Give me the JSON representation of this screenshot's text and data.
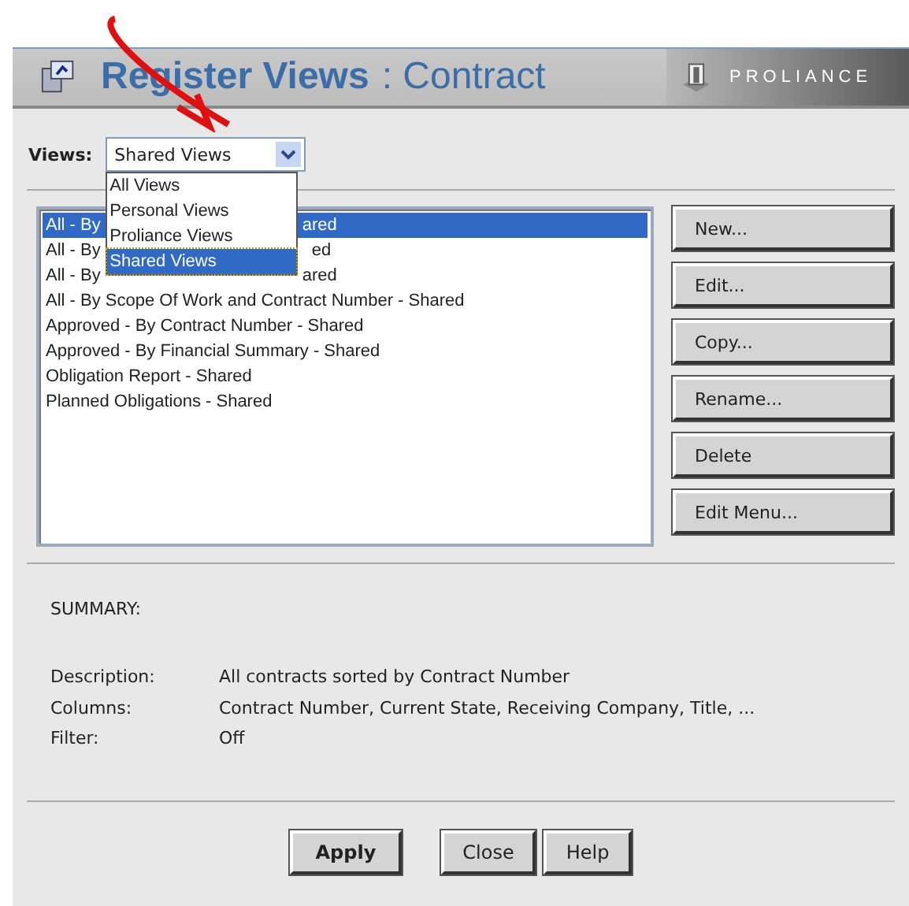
{
  "header": {
    "title": "Register Views",
    "subtitle": ": Contract",
    "brand": "PROLIANCE"
  },
  "views": {
    "label": "Views:",
    "value": "Shared Views",
    "expanded": true,
    "options": [
      {
        "label": "All Views",
        "selected": false
      },
      {
        "label": "Personal Views",
        "selected": false
      },
      {
        "label": "Proliance Views",
        "selected": false
      },
      {
        "label": "Shared Views",
        "selected": true
      }
    ]
  },
  "view_list": [
    {
      "parts": [
        "All - By",
        "ared"
      ],
      "selected": true
    },
    {
      "parts": [
        "All - By",
        "ed"
      ],
      "selected": false
    },
    {
      "parts": [
        "All - By",
        "ared"
      ],
      "selected": false
    },
    {
      "parts": [
        "All - By Scope Of Work and Contract Number - Shared"
      ],
      "selected": false
    },
    {
      "parts": [
        "Approved - By Contract Number - Shared"
      ],
      "selected": false
    },
    {
      "parts": [
        "Approved - By Financial Summary - Shared"
      ],
      "selected": false
    },
    {
      "parts": [
        "Obligation Report - Shared"
      ],
      "selected": false
    },
    {
      "parts": [
        "Planned Obligations - Shared"
      ],
      "selected": false
    }
  ],
  "actions": [
    "New...",
    "Edit...",
    "Copy...",
    "Rename...",
    "Delete",
    "Edit Menu..."
  ],
  "summary": {
    "heading": "SUMMARY:",
    "rows": [
      {
        "label": "Description:",
        "value": "All contracts sorted by Contract Number"
      },
      {
        "label": "Columns:",
        "value": "Contract Number, Current State, Receiving Company, Title, ..."
      },
      {
        "label": "Filter:",
        "value": "Off"
      }
    ]
  },
  "footer_buttons": [
    {
      "label": "Apply",
      "default": true
    },
    {
      "label": "Close",
      "default": false
    },
    {
      "label": "Help",
      "default": false
    }
  ]
}
